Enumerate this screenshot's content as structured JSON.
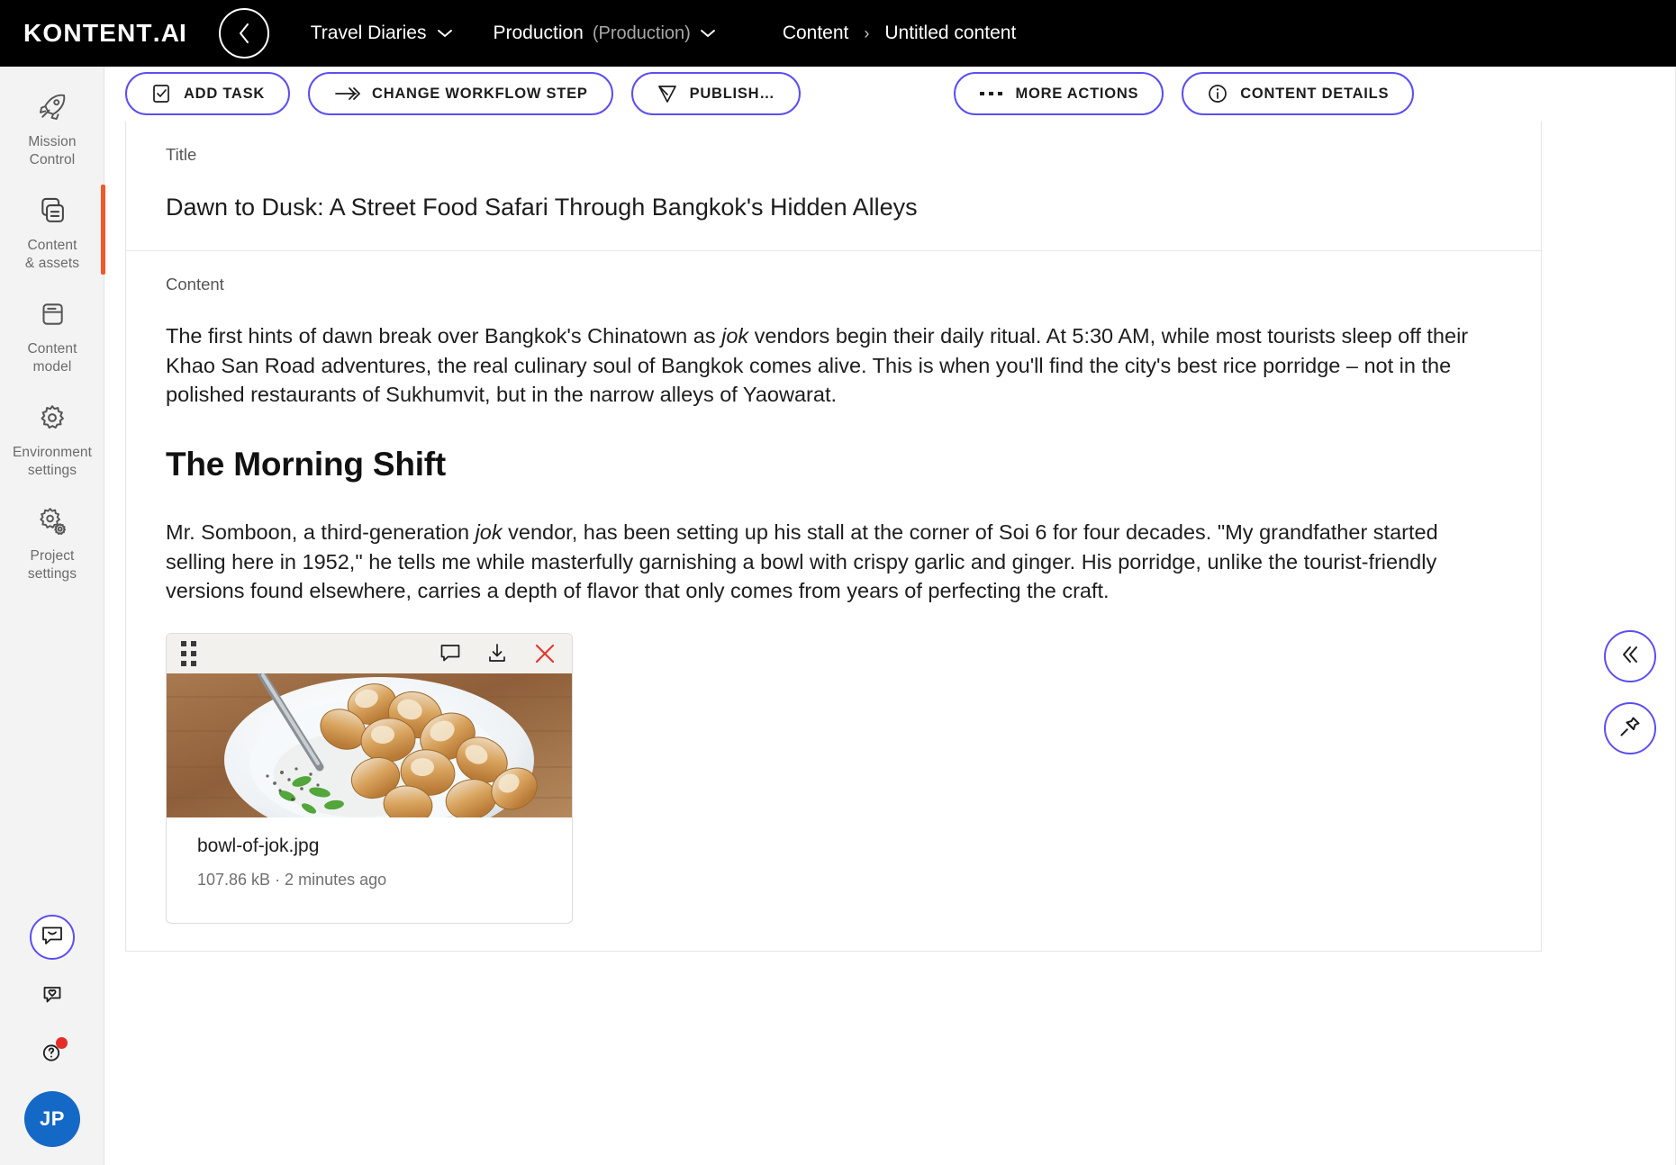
{
  "topbar": {
    "logo_text": "KONTENT",
    "logo_dot": ".",
    "logo_ai": "AI",
    "back_icon": "chevron-left-icon",
    "project_name": "Travel Diaries",
    "environment_name": "Production",
    "environment_sub": "(Production)",
    "breadcrumb": {
      "parent": "Content",
      "separator": "›",
      "current": "Untitled content"
    }
  },
  "sidebar": {
    "items": [
      {
        "label": "Mission\nControl",
        "line1": "Mission",
        "line2": "Control",
        "icon": "rocket-icon",
        "active": false
      },
      {
        "label": "Content & assets",
        "line1": "Content",
        "line2": "& assets",
        "icon": "content-assets-icon",
        "active": true
      },
      {
        "label": "Content model",
        "line1": "Content",
        "line2": "model",
        "icon": "content-model-icon",
        "active": false
      },
      {
        "label": "Environment settings",
        "line1": "Environment",
        "line2": "settings",
        "icon": "gear-icon",
        "active": false
      },
      {
        "label": "Project settings",
        "line1": "Project",
        "line2": "settings",
        "icon": "double-gear-icon",
        "active": false
      }
    ],
    "bottom": [
      {
        "name": "feedback-smiley-icon",
        "label": "Feedback"
      },
      {
        "name": "heart-chat-icon",
        "label": "Suggestions"
      },
      {
        "name": "help-question-icon",
        "label": "Help",
        "has_badge": true
      }
    ],
    "avatar_initials": "JP"
  },
  "toolbar": {
    "buttons": [
      {
        "label": "ADD TASK",
        "icon": "checkbox-icon"
      },
      {
        "label": "CHANGE WORKFLOW STEP",
        "icon": "arrow-right-icon"
      },
      {
        "label": "PUBLISH…",
        "icon": "paper-plane-icon"
      },
      {
        "label": "MORE ACTIONS",
        "icon": "ellipsis-icon"
      },
      {
        "label": "CONTENT DETAILS",
        "icon": "info-icon"
      }
    ]
  },
  "editor": {
    "title_field": {
      "label": "Title",
      "value": "Dawn to Dusk: A Street Food Safari Through Bangkok's Hidden Alleys"
    },
    "content_field": {
      "label": "Content",
      "paragraph_1_a": "The first hints of dawn break over Bangkok's Chinatown as ",
      "paragraph_1_em": "jok",
      "paragraph_1_b": " vendors begin their daily ritual. At 5:30 AM, while most tourists sleep off their Khao San Road adventures, the real culinary soul of Bangkok comes alive. This is when you'll find the city's best rice porridge – not in the polished restaurants of Sukhumvit, but in the narrow alleys of Yaowarat.",
      "heading_2": "The Morning Shift",
      "paragraph_2_a": "Mr. Somboon, a third-generation ",
      "paragraph_2_em": "jok",
      "paragraph_2_b": " vendor, has been setting up his stall at the corner of Soi 6 for four decades. \"My grandfather started selling here in 1952,\" he tells me while masterfully garnishing a bowl with crispy garlic and ginger. His porridge, unlike the tourist-friendly versions found elsewhere, carries a depth of flavor that only comes from years of perfecting the craft."
    },
    "asset": {
      "drag_handle_icon": "drag-dots-icon",
      "comment_icon": "comment-icon",
      "download_icon": "download-icon",
      "remove_icon": "close-x-icon",
      "filename": "bowl-of-jok.jpg",
      "size": "107.86 kB",
      "separator": "·",
      "modified": "2 minutes ago",
      "meta_line": "107.86 kB · 2 minutes ago"
    }
  },
  "right_panel": {
    "collapse_icon": "double-chevron-left-icon",
    "pin_icon": "pin-icon"
  },
  "colors": {
    "accent_purple": "#5b4ff0",
    "active_marker": "#f05a28",
    "avatar_blue": "#1469c7",
    "badge_red": "#e52d27",
    "close_red": "#e03b2f",
    "topbar_black": "#000000",
    "rail_grey": "#f3f3f3"
  }
}
